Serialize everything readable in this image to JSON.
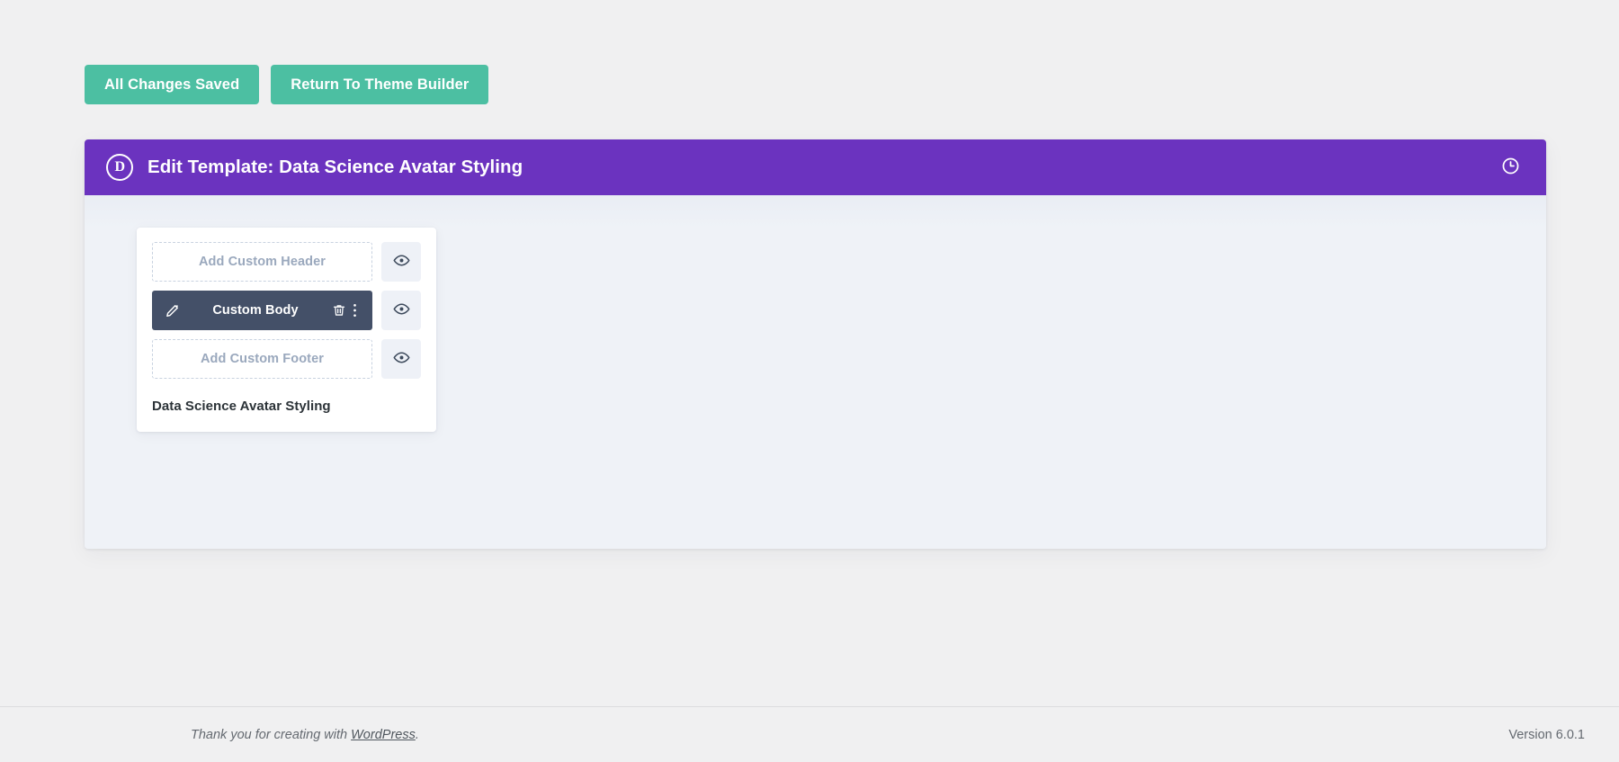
{
  "topbar": {
    "save_button": "All Changes Saved",
    "return_button": "Return To Theme Builder"
  },
  "panel": {
    "logo_letter": "D",
    "title": "Edit Template: Data Science Avatar Styling",
    "history_icon": "clock-icon",
    "accent_color": "#6b33bf"
  },
  "template_card": {
    "rows": [
      {
        "label": "Add Custom Header",
        "state": "empty",
        "name": "header",
        "eye_icon": "eye-icon"
      },
      {
        "label": "Custom Body",
        "state": "filled",
        "name": "body",
        "edit_icon": "pencil-icon",
        "delete_icon": "trash-icon",
        "more_icon": "ellipsis-vertical-icon",
        "eye_icon": "eye-icon"
      },
      {
        "label": "Add Custom Footer",
        "state": "empty",
        "name": "footer",
        "eye_icon": "eye-icon"
      }
    ],
    "template_name": "Data Science Avatar Styling"
  },
  "footer": {
    "thanks_prefix": "Thank you for creating with ",
    "thanks_link": "WordPress",
    "thanks_suffix": ".",
    "version": "Version 6.0.1"
  },
  "colors": {
    "green": "#4cbfa2",
    "purple": "#6b33bf",
    "dark_slate": "#445068",
    "panel_bg": "#eff2f7",
    "page_bg": "#f0f0f1"
  }
}
